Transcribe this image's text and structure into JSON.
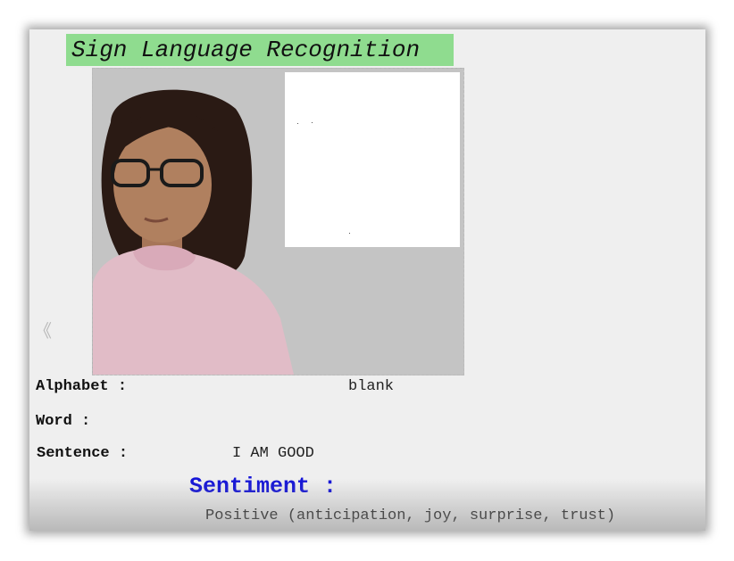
{
  "app": {
    "title": "Sign Language Recognition"
  },
  "navigation": {
    "back_glyph": "《"
  },
  "results": {
    "alphabet_label": "Alphabet :",
    "alphabet_value": "blank",
    "word_label": "Word :",
    "word_value": "",
    "sentence_label": "Sentence :",
    "sentence_value": "I AM GOOD",
    "sentiment_label": "Sentiment :",
    "sentiment_value": "Positive (anticipation, joy, surprise, trust)"
  },
  "colors": {
    "title_background": "#8fdc8f",
    "sentiment_label": "#1414d8",
    "window_background": "#efefef"
  }
}
